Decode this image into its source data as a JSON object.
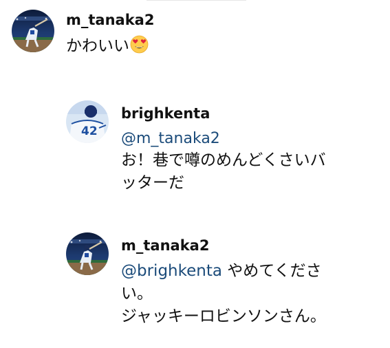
{
  "comments": [
    {
      "username": "m_tanaka2",
      "avatar_icon": "baseball-player-batting-avatar",
      "text": "かわいい",
      "emoji": "heart-eyes-emoji"
    },
    {
      "username": "brighkenta",
      "avatar_icon": "player-42-avatar",
      "mention": "@m_tanaka2",
      "lines": [
        "お！巷で噂のめんどくさいバ",
        "ッターだ"
      ]
    },
    {
      "username": "m_tanaka2",
      "avatar_icon": "baseball-player-batting-avatar",
      "mention": "@brighkenta",
      "lines": [
        "やめてくださ",
        "い。",
        "ジャッキーロビンソンさん。"
      ]
    }
  ],
  "colors": {
    "mention": "#1b4b7a",
    "text": "#111111"
  }
}
